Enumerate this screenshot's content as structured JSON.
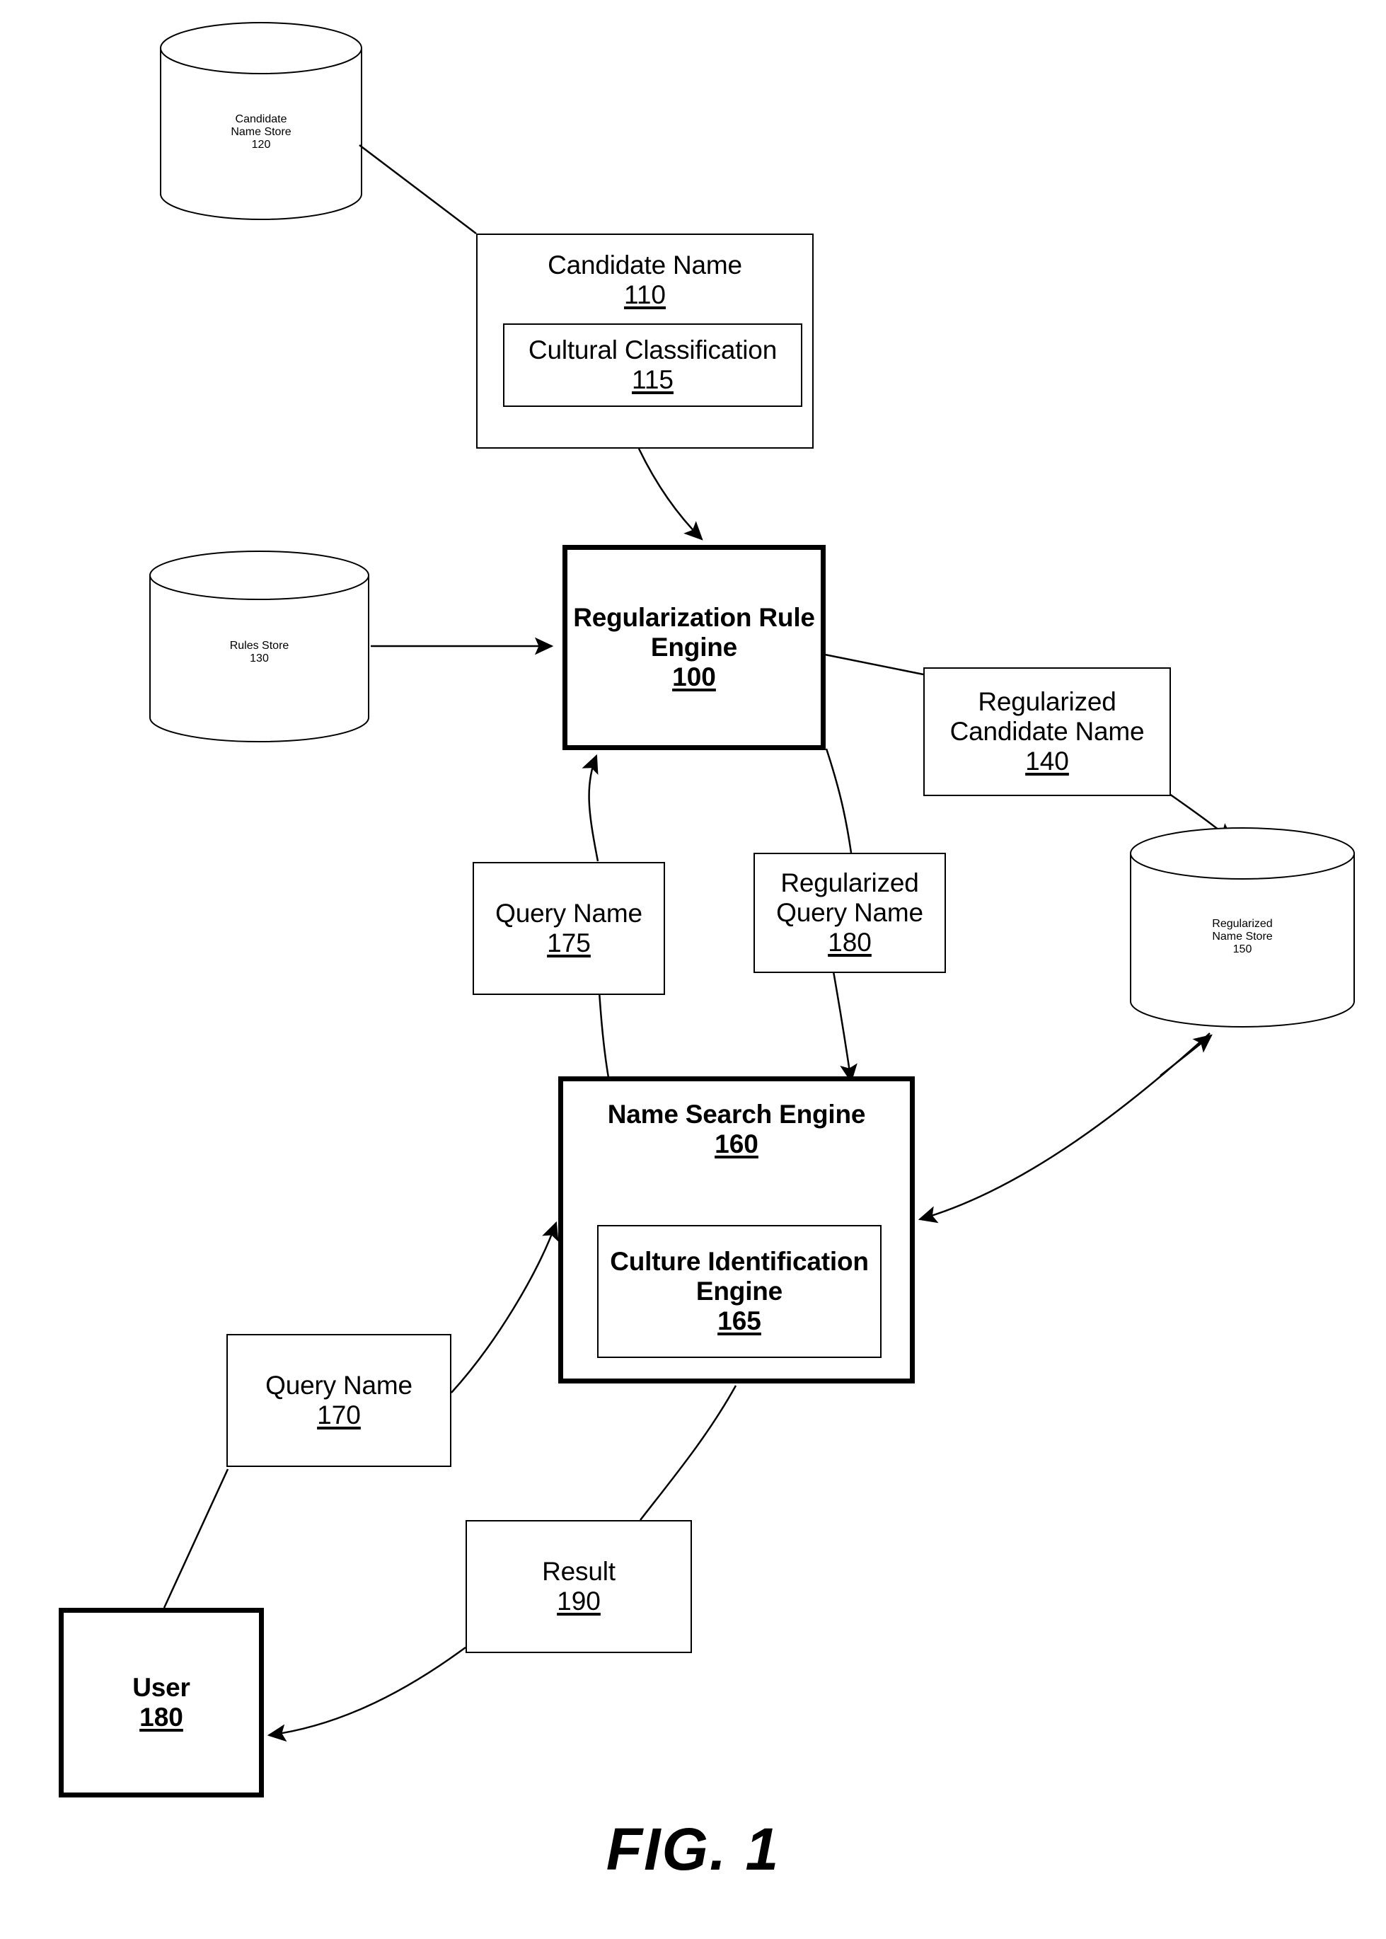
{
  "figure": {
    "caption": "FIG. 1"
  },
  "nodes": {
    "candidate_name_store": {
      "line1": "Candidate",
      "line2": "Name Store",
      "ref": "120"
    },
    "candidate_name": {
      "line1": "Candidate Name",
      "ref": "110"
    },
    "cultural_classification": {
      "line1": "Cultural Classification",
      "ref": "115"
    },
    "rules_store": {
      "line1": "Rules Store",
      "ref": "130"
    },
    "regularization_rule_engine": {
      "line1": "Regularization Rule",
      "line2": "Engine",
      "ref": "100"
    },
    "regularized_candidate_name": {
      "line1": "Regularized",
      "line2": "Candidate Name",
      "ref": "140"
    },
    "regularized_name_store": {
      "line1": "Regularized",
      "line2": "Name Store",
      "ref": "150"
    },
    "query_name_175": {
      "line1": "Query Name",
      "ref": "175"
    },
    "regularized_query_name": {
      "line1": "Regularized",
      "line2": "Query Name",
      "ref": "180"
    },
    "name_search_engine": {
      "line1": "Name Search Engine",
      "ref": "160"
    },
    "culture_identification_engine": {
      "line1": "Culture Identification",
      "line2": "Engine",
      "ref": "165"
    },
    "query_name_170": {
      "line1": "Query Name",
      "ref": "170"
    },
    "result": {
      "line1": "Result",
      "ref": "190"
    },
    "user": {
      "line1": "User",
      "ref": "180"
    }
  },
  "colors": {
    "ink": "#000000",
    "paper": "#ffffff"
  }
}
